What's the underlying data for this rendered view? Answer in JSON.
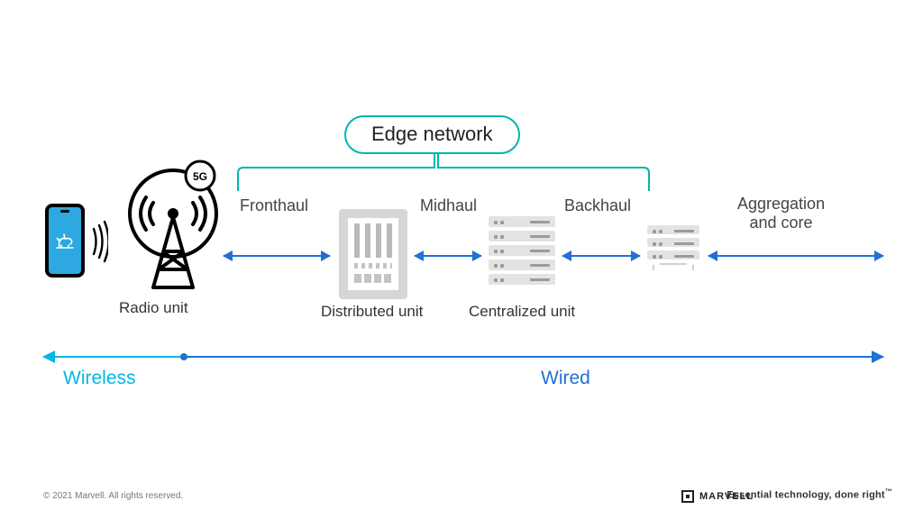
{
  "diagram": {
    "title_pill": "Edge network",
    "segments": {
      "fronthaul": "Fronthaul",
      "midhaul": "Midhaul",
      "backhaul": "Backhaul"
    },
    "nodes": {
      "radio": "Radio unit",
      "du": "Distributed unit",
      "cu": "Centralized unit",
      "agg": "Aggregation\nand core"
    },
    "five_g": "5G",
    "spectrum": {
      "wireless": "Wireless",
      "wired": "Wired"
    }
  },
  "footer": {
    "copyright": "© 2021 Marvell. All rights reserved.",
    "brand": "MARVELL",
    "tagline": "Essential technology, done right",
    "tm": "™"
  },
  "colors": {
    "teal": "#00b7a8",
    "arrow_blue": "#1f71d4",
    "wireless_cyan": "#00b6e6",
    "gray_icon": "#cfcfcf"
  }
}
